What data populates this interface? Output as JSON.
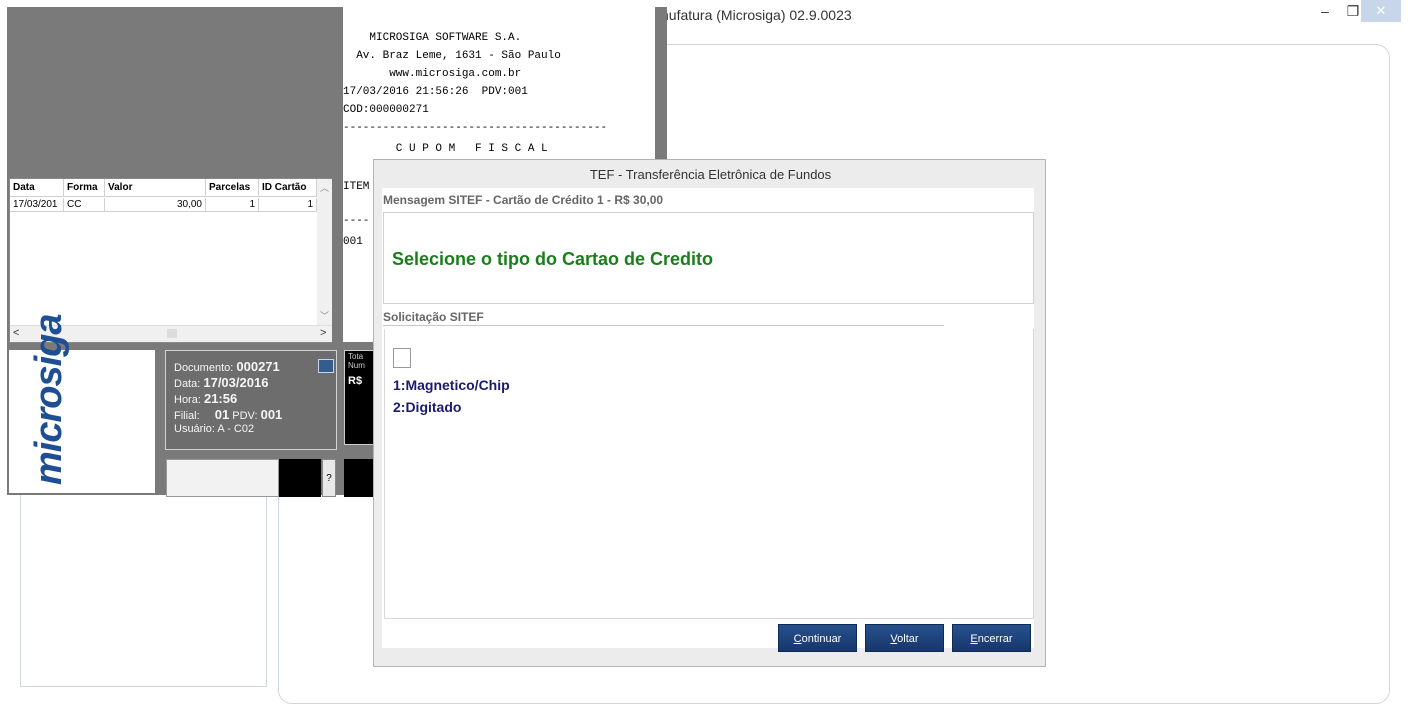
{
  "app": {
    "title": "nufatura (Microsiga) 02.9.0023",
    "minimize_glyph": "–",
    "maximize_glyph": "❐",
    "close_glyph": "✕"
  },
  "payments_table": {
    "columns": [
      "Data",
      "Forma",
      "Valor",
      "Parcelas",
      "ID Cartão"
    ],
    "rows": [
      {
        "data": "17/03/201",
        "forma": "CC",
        "valor": "30,00",
        "parcelas": "1",
        "id_cartao": "1"
      }
    ]
  },
  "logo": {
    "text": "microsiga"
  },
  "doc_info": {
    "documento_label": "Documento:",
    "documento": "000271",
    "data_label": "Data:",
    "data": "17/03/2016",
    "hora_label": "Hora:",
    "hora": "21:56",
    "filial_label": "Filial:",
    "filial": "01",
    "pdv_label": "PDV:",
    "pdv": "001",
    "usuario_label": "Usuário:",
    "usuario": "A - C02",
    "help_label": "?"
  },
  "totals": {
    "label_1": "Tota",
    "label_2": "Num",
    "currency": "R$"
  },
  "receipt": {
    "line1": "    MICROSIGA SOFTWARE S.A.",
    "line2": "  Av. Braz Leme, 1631 - São Paulo",
    "line3": "       www.microsiga.com.br",
    "line4": "17/03/2016 21:56:26  PDV:001",
    "line5": "COD:000000271",
    "line6": "----------------------------------------",
    "line7": "        C U P O M   F I S C A L",
    "line8": "ITEM",
    "line9": "----",
    "line10": "001"
  },
  "tef": {
    "title": "TEF - Transferência Eletrônica de Fundos",
    "message_header": "Mensagem SITEF - Cartão de Crédito 1 - R$ 30,00",
    "message_text": "Selecione o tipo do Cartao de Credito",
    "request_header": "Solicitação SITEF",
    "input_value": "",
    "options": [
      "1:Magnetico/Chip",
      "2:Digitado"
    ],
    "buttons": {
      "continuar": "Continuar",
      "voltar": "Voltar",
      "encerrar": "Encerrar"
    }
  },
  "colors": {
    "accent": "#1e4f94",
    "message_green": "#1a7f1a",
    "option_navy": "#1a1a6e",
    "button_blue": "#1f4680"
  }
}
